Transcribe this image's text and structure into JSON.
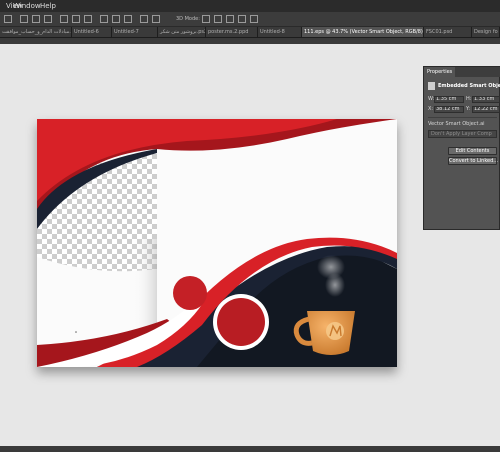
{
  "menubar": {
    "items": [
      {
        "label": "View"
      },
      {
        "label": "Window"
      },
      {
        "label": "Help"
      }
    ]
  },
  "options_bar": {
    "mode_3d": "3D Mode:"
  },
  "tabs": [
    {
      "label": "مبادلات الدام_و_حساب_موافقت.pdf"
    },
    {
      "label": "Untitled-6"
    },
    {
      "label": "Untitled-7"
    },
    {
      "label": "بروشور متن شکر.ps2"
    },
    {
      "label": "poster.ms.2.ppd"
    },
    {
      "label": "Untitled-8"
    },
    {
      "label": "111.eps @ 43.7% (Vector Smart Object, RGB/8) *"
    },
    {
      "label": "FSC01.psd"
    },
    {
      "label": "Design fo"
    }
  ],
  "properties_panel": {
    "tab_label": "Properties",
    "title": "Embedded Smart Object",
    "w_label": "W:",
    "w_value": "1.35 cm",
    "h_label": "H:",
    "h_value": "1.33 cm",
    "x_label": "X:",
    "x_value": "38.12 cm",
    "y_label": "Y:",
    "y_value": "12.22 cm",
    "file_name": "Vector Smart Object.ai",
    "layer_comp": "Don't Apply Layer Comp",
    "edit_contents": "Edit Contents",
    "convert_linked": "Convert to Linked..."
  },
  "colors": {
    "accent_red": "#d82127",
    "dark_red": "#a5161c",
    "navy": "#1a2233",
    "mug": "#e59a4a"
  },
  "icons": [
    "move-tool-icon",
    "smart-object-icon",
    "dropdown-arrow-icon",
    "close-tab-icon"
  ]
}
